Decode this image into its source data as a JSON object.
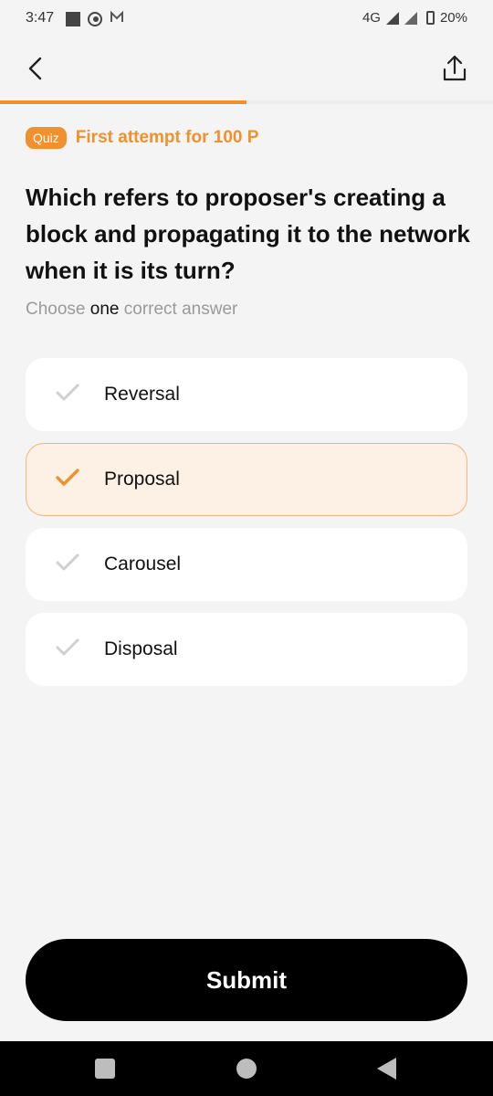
{
  "status_bar": {
    "time": "3:47",
    "network": "4G",
    "battery": "20%",
    "icons": [
      "square-icon",
      "circle-icon",
      "mail-icon",
      "signal-icon",
      "battery-icon"
    ]
  },
  "header": {
    "back_icon": "chevron-left-icon",
    "share_icon": "share-icon"
  },
  "progress": {
    "fraction": 0.5,
    "color": "#f0902e"
  },
  "quiz": {
    "badge": "Quiz",
    "reward": "First attempt for 100 P"
  },
  "question": {
    "text": "Which refers to proposer's creating a block and propagating it to the network when it is its turn?",
    "instruction_pre": "Choose",
    "instruction_em": "one",
    "instruction_post": "correct answer"
  },
  "options": [
    {
      "label": "Reversal",
      "selected": false
    },
    {
      "label": "Proposal",
      "selected": true
    },
    {
      "label": "Carousel",
      "selected": false
    },
    {
      "label": "Disposal",
      "selected": false
    }
  ],
  "submit": {
    "label": "Submit"
  },
  "colors": {
    "accent": "#f0902e",
    "selected_bg": "#fdf0e4",
    "check_inactive": "#cfcfcf"
  }
}
